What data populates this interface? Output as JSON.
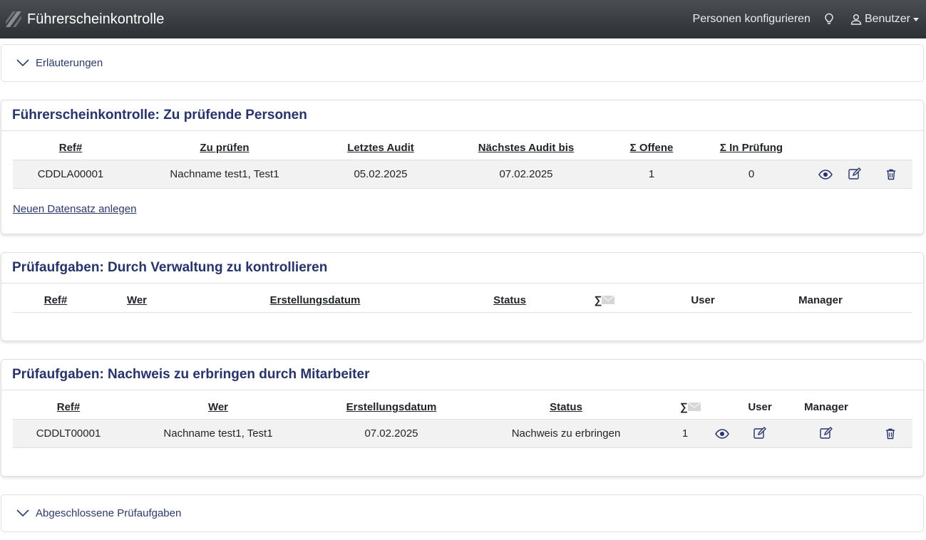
{
  "navbar": {
    "brand": "Führerscheinkontrolle",
    "link_persons": "Personen konfigurieren",
    "user_label": "Benutzer"
  },
  "explanations": {
    "label": "Erläuterungen"
  },
  "persons_card": {
    "title": "Führerscheinkontrolle: Zu prüfende Personen",
    "headers": [
      "Ref#",
      "Zu prüfen",
      "Letztes Audit",
      "Nächstes Audit bis",
      "Σ Offene",
      "Σ In Prüfung"
    ],
    "rows": [
      {
        "ref": "CDDLA00001",
        "name": "Nachname test1, Test1",
        "last_audit": "05.02.2025",
        "next_audit": "07.02.2025",
        "open": "1",
        "in_review": "0"
      }
    ],
    "new_link": "Neuen Datensatz anlegen"
  },
  "admin_card": {
    "title": "Prüfaufgaben: Durch Verwaltung zu kontrollieren",
    "headers": [
      "Ref#",
      "Wer",
      "Erstellungsdatum",
      "Status",
      "∑",
      "User",
      "Manager"
    ]
  },
  "employee_card": {
    "title": "Prüfaufgaben: Nachweis zu erbringen durch Mitarbeiter",
    "headers": [
      "Ref#",
      "Wer",
      "Erstellungsdatum",
      "Status",
      "∑",
      "User",
      "Manager"
    ],
    "rows": [
      {
        "ref": "CDDLT00001",
        "name": "Nachname test1, Test1",
        "created": "07.02.2025",
        "status": "Nachweis zu erbringen",
        "count": "1"
      }
    ]
  },
  "closed": {
    "label": "Abgeschlossene Prüfaufgaben"
  },
  "colors": {
    "accent": "#253470",
    "navbar": "#3a3d41",
    "row": "#f2f2f2"
  }
}
